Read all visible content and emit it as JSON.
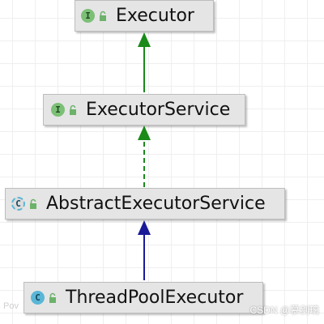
{
  "diagram": {
    "nodes": [
      {
        "id": "executor",
        "name": "Executor",
        "kind": "interface",
        "badge": "I",
        "access": "public"
      },
      {
        "id": "executor-service",
        "name": "ExecutorService",
        "kind": "interface",
        "badge": "I",
        "access": "public"
      },
      {
        "id": "abstract-executor-service",
        "name": "AbstractExecutorService",
        "kind": "abstract-class",
        "badge": "C",
        "access": "public"
      },
      {
        "id": "thread-pool-executor",
        "name": "ThreadPoolExecutor",
        "kind": "class",
        "badge": "C",
        "access": "public"
      }
    ],
    "edges": [
      {
        "from": "executor-service",
        "to": "executor",
        "type": "extends",
        "style": "solid",
        "color": "#1a8a1a"
      },
      {
        "from": "abstract-executor-service",
        "to": "executor-service",
        "type": "implements",
        "style": "dashed",
        "color": "#1a8a1a"
      },
      {
        "from": "thread-pool-executor",
        "to": "abstract-executor-service",
        "type": "extends",
        "style": "solid",
        "color": "#1a1a99"
      }
    ]
  },
  "colors": {
    "interface_badge": "#7cbf76",
    "class_badge": "#5ab6d6",
    "node_fill": "#e5e5e5",
    "interface_edge": "#1a8a1a",
    "class_edge": "#1a1a99",
    "lock_icon": "#6cb26a"
  },
  "footer": {
    "left_text": "Pov",
    "watermark": "CSDN @慕剑璃"
  }
}
